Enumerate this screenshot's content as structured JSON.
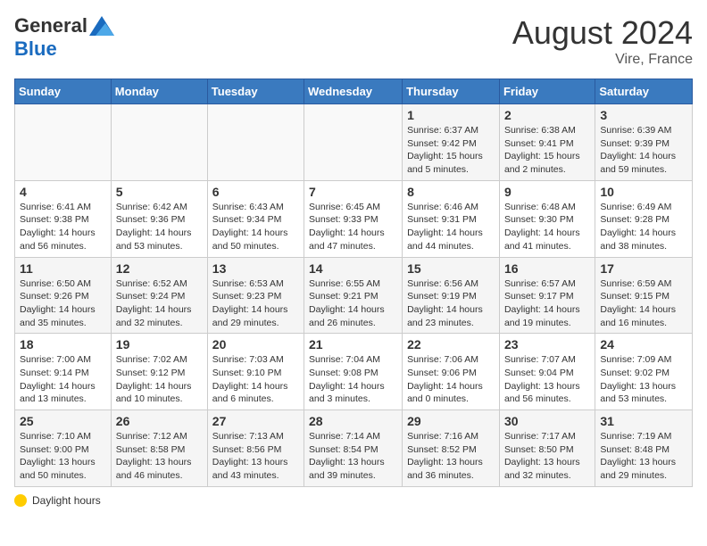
{
  "header": {
    "logo_general": "General",
    "logo_blue": "Blue",
    "month_year": "August 2024",
    "location": "Vire, France"
  },
  "days_of_week": [
    "Sunday",
    "Monday",
    "Tuesday",
    "Wednesday",
    "Thursday",
    "Friday",
    "Saturday"
  ],
  "weeks": [
    [
      {
        "day": "",
        "sunrise": "",
        "sunset": "",
        "daylight": ""
      },
      {
        "day": "",
        "sunrise": "",
        "sunset": "",
        "daylight": ""
      },
      {
        "day": "",
        "sunrise": "",
        "sunset": "",
        "daylight": ""
      },
      {
        "day": "",
        "sunrise": "",
        "sunset": "",
        "daylight": ""
      },
      {
        "day": "1",
        "sunrise": "Sunrise: 6:37 AM",
        "sunset": "Sunset: 9:42 PM",
        "daylight": "Daylight: 15 hours and 5 minutes."
      },
      {
        "day": "2",
        "sunrise": "Sunrise: 6:38 AM",
        "sunset": "Sunset: 9:41 PM",
        "daylight": "Daylight: 15 hours and 2 minutes."
      },
      {
        "day": "3",
        "sunrise": "Sunrise: 6:39 AM",
        "sunset": "Sunset: 9:39 PM",
        "daylight": "Daylight: 14 hours and 59 minutes."
      }
    ],
    [
      {
        "day": "4",
        "sunrise": "Sunrise: 6:41 AM",
        "sunset": "Sunset: 9:38 PM",
        "daylight": "Daylight: 14 hours and 56 minutes."
      },
      {
        "day": "5",
        "sunrise": "Sunrise: 6:42 AM",
        "sunset": "Sunset: 9:36 PM",
        "daylight": "Daylight: 14 hours and 53 minutes."
      },
      {
        "day": "6",
        "sunrise": "Sunrise: 6:43 AM",
        "sunset": "Sunset: 9:34 PM",
        "daylight": "Daylight: 14 hours and 50 minutes."
      },
      {
        "day": "7",
        "sunrise": "Sunrise: 6:45 AM",
        "sunset": "Sunset: 9:33 PM",
        "daylight": "Daylight: 14 hours and 47 minutes."
      },
      {
        "day": "8",
        "sunrise": "Sunrise: 6:46 AM",
        "sunset": "Sunset: 9:31 PM",
        "daylight": "Daylight: 14 hours and 44 minutes."
      },
      {
        "day": "9",
        "sunrise": "Sunrise: 6:48 AM",
        "sunset": "Sunset: 9:30 PM",
        "daylight": "Daylight: 14 hours and 41 minutes."
      },
      {
        "day": "10",
        "sunrise": "Sunrise: 6:49 AM",
        "sunset": "Sunset: 9:28 PM",
        "daylight": "Daylight: 14 hours and 38 minutes."
      }
    ],
    [
      {
        "day": "11",
        "sunrise": "Sunrise: 6:50 AM",
        "sunset": "Sunset: 9:26 PM",
        "daylight": "Daylight: 14 hours and 35 minutes."
      },
      {
        "day": "12",
        "sunrise": "Sunrise: 6:52 AM",
        "sunset": "Sunset: 9:24 PM",
        "daylight": "Daylight: 14 hours and 32 minutes."
      },
      {
        "day": "13",
        "sunrise": "Sunrise: 6:53 AM",
        "sunset": "Sunset: 9:23 PM",
        "daylight": "Daylight: 14 hours and 29 minutes."
      },
      {
        "day": "14",
        "sunrise": "Sunrise: 6:55 AM",
        "sunset": "Sunset: 9:21 PM",
        "daylight": "Daylight: 14 hours and 26 minutes."
      },
      {
        "day": "15",
        "sunrise": "Sunrise: 6:56 AM",
        "sunset": "Sunset: 9:19 PM",
        "daylight": "Daylight: 14 hours and 23 minutes."
      },
      {
        "day": "16",
        "sunrise": "Sunrise: 6:57 AM",
        "sunset": "Sunset: 9:17 PM",
        "daylight": "Daylight: 14 hours and 19 minutes."
      },
      {
        "day": "17",
        "sunrise": "Sunrise: 6:59 AM",
        "sunset": "Sunset: 9:15 PM",
        "daylight": "Daylight: 14 hours and 16 minutes."
      }
    ],
    [
      {
        "day": "18",
        "sunrise": "Sunrise: 7:00 AM",
        "sunset": "Sunset: 9:14 PM",
        "daylight": "Daylight: 14 hours and 13 minutes."
      },
      {
        "day": "19",
        "sunrise": "Sunrise: 7:02 AM",
        "sunset": "Sunset: 9:12 PM",
        "daylight": "Daylight: 14 hours and 10 minutes."
      },
      {
        "day": "20",
        "sunrise": "Sunrise: 7:03 AM",
        "sunset": "Sunset: 9:10 PM",
        "daylight": "Daylight: 14 hours and 6 minutes."
      },
      {
        "day": "21",
        "sunrise": "Sunrise: 7:04 AM",
        "sunset": "Sunset: 9:08 PM",
        "daylight": "Daylight: 14 hours and 3 minutes."
      },
      {
        "day": "22",
        "sunrise": "Sunrise: 7:06 AM",
        "sunset": "Sunset: 9:06 PM",
        "daylight": "Daylight: 14 hours and 0 minutes."
      },
      {
        "day": "23",
        "sunrise": "Sunrise: 7:07 AM",
        "sunset": "Sunset: 9:04 PM",
        "daylight": "Daylight: 13 hours and 56 minutes."
      },
      {
        "day": "24",
        "sunrise": "Sunrise: 7:09 AM",
        "sunset": "Sunset: 9:02 PM",
        "daylight": "Daylight: 13 hours and 53 minutes."
      }
    ],
    [
      {
        "day": "25",
        "sunrise": "Sunrise: 7:10 AM",
        "sunset": "Sunset: 9:00 PM",
        "daylight": "Daylight: 13 hours and 50 minutes."
      },
      {
        "day": "26",
        "sunrise": "Sunrise: 7:12 AM",
        "sunset": "Sunset: 8:58 PM",
        "daylight": "Daylight: 13 hours and 46 minutes."
      },
      {
        "day": "27",
        "sunrise": "Sunrise: 7:13 AM",
        "sunset": "Sunset: 8:56 PM",
        "daylight": "Daylight: 13 hours and 43 minutes."
      },
      {
        "day": "28",
        "sunrise": "Sunrise: 7:14 AM",
        "sunset": "Sunset: 8:54 PM",
        "daylight": "Daylight: 13 hours and 39 minutes."
      },
      {
        "day": "29",
        "sunrise": "Sunrise: 7:16 AM",
        "sunset": "Sunset: 8:52 PM",
        "daylight": "Daylight: 13 hours and 36 minutes."
      },
      {
        "day": "30",
        "sunrise": "Sunrise: 7:17 AM",
        "sunset": "Sunset: 8:50 PM",
        "daylight": "Daylight: 13 hours and 32 minutes."
      },
      {
        "day": "31",
        "sunrise": "Sunrise: 7:19 AM",
        "sunset": "Sunset: 8:48 PM",
        "daylight": "Daylight: 13 hours and 29 minutes."
      }
    ]
  ],
  "footer": {
    "legend_label": "Daylight hours"
  }
}
